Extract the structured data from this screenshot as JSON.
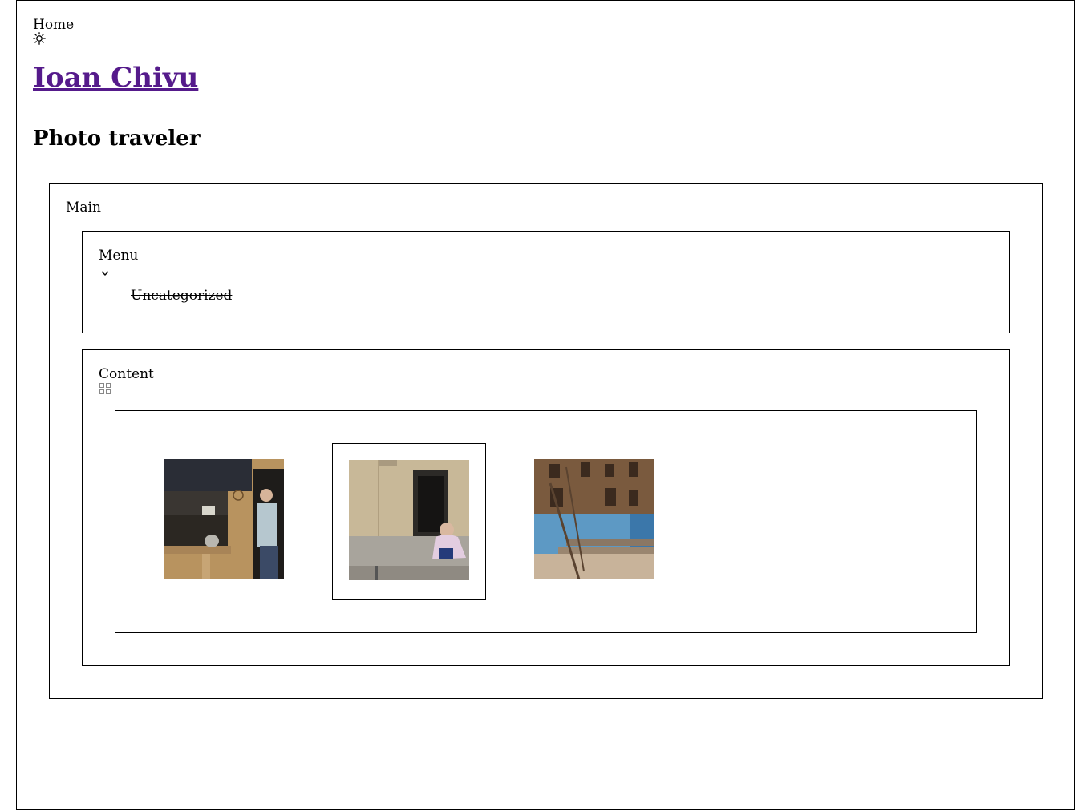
{
  "nav": {
    "home_label": "Home",
    "theme_toggle_icon": "sun-icon"
  },
  "site": {
    "title": "Ioan Chivu",
    "tagline": "Photo traveler",
    "title_link_color": "#551a8b"
  },
  "main": {
    "label": "Main",
    "menu": {
      "label": "Menu",
      "toggle_icon": "chevron-down-icon",
      "items": [
        {
          "label": "Uncategorized"
        }
      ]
    },
    "content": {
      "label": "Content",
      "view_icon": "grid-icon",
      "gallery": [
        {
          "name": "man-in-doorway-photo"
        },
        {
          "name": "child-on-step-photo"
        },
        {
          "name": "old-building-corner-photo"
        }
      ]
    }
  }
}
